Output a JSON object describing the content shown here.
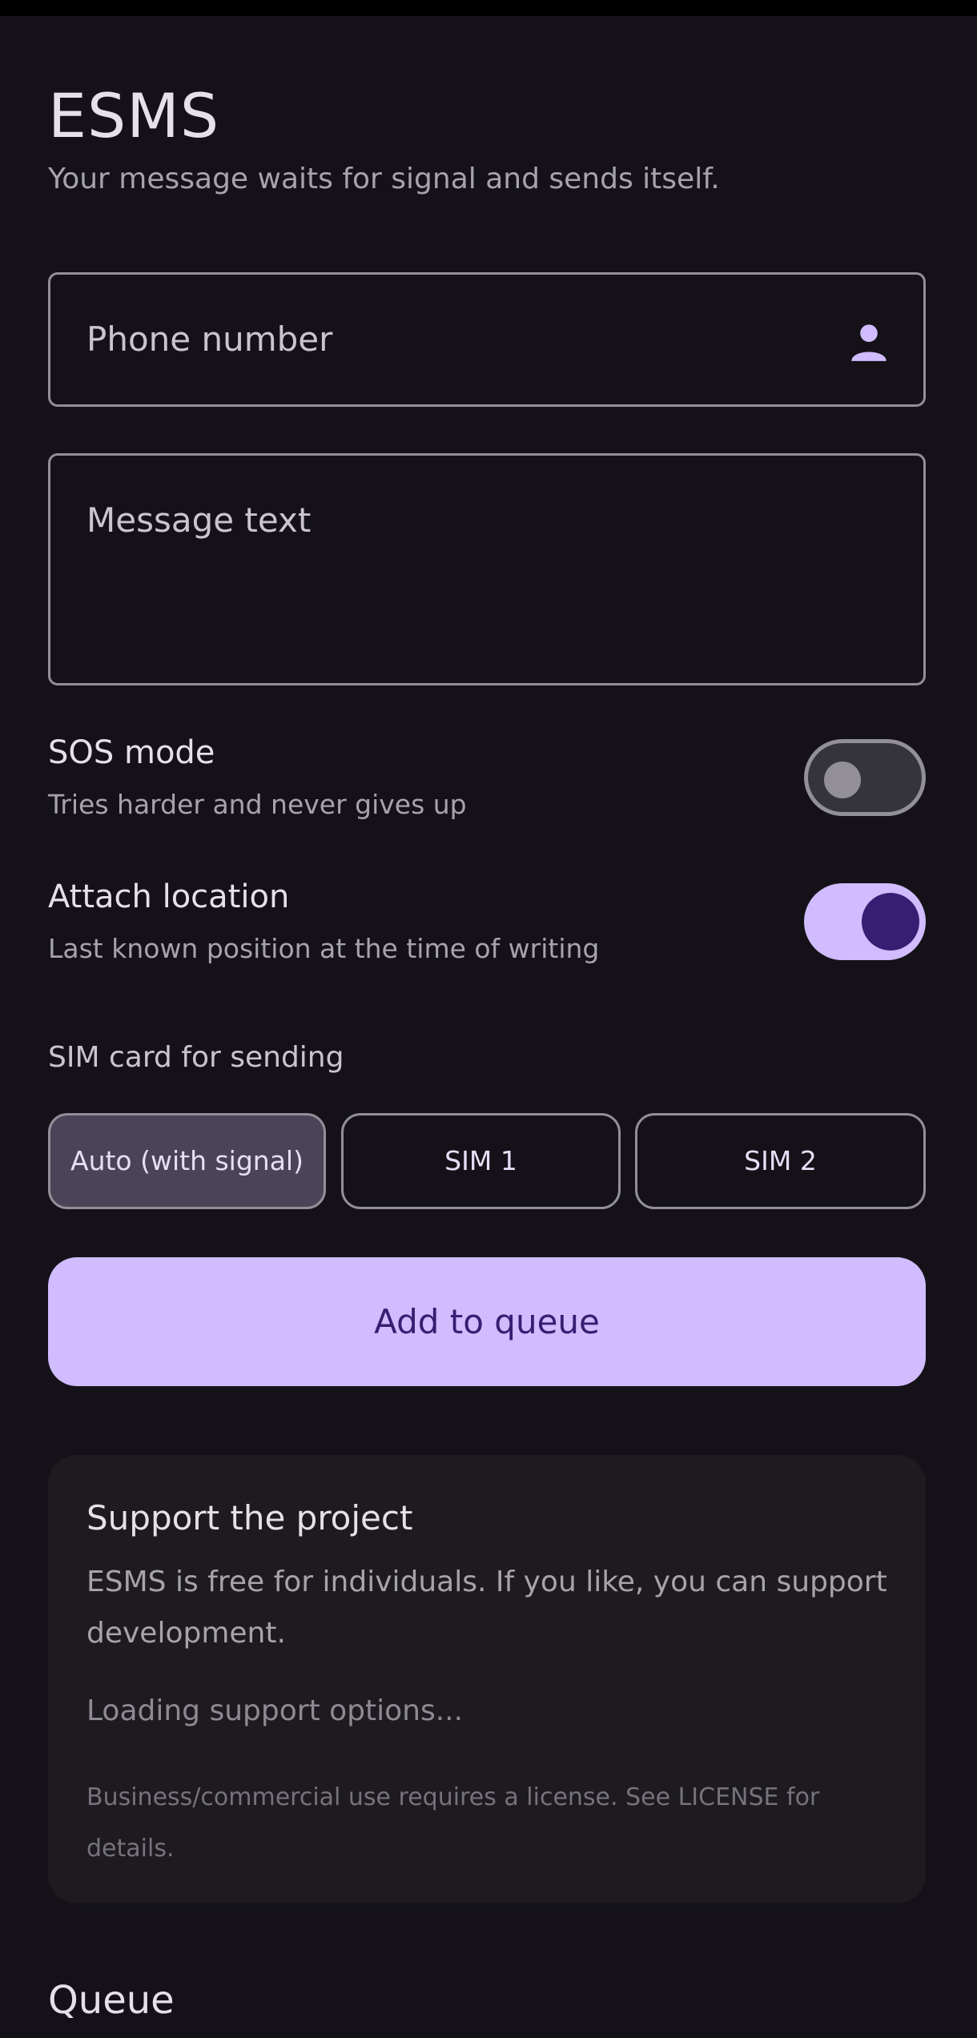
{
  "app": {
    "title": "ESMS",
    "subtitle": "Your message waits for signal and sends itself."
  },
  "form": {
    "phone_placeholder": "Phone number",
    "phone_icon": "person-icon",
    "message_placeholder": "Message text"
  },
  "settings": {
    "sos": {
      "title": "SOS mode",
      "description": "Tries harder and never gives up",
      "enabled": false
    },
    "location": {
      "title": "Attach location",
      "description": "Last known position at the time of writing",
      "enabled": true
    }
  },
  "sim": {
    "label": "SIM card for sending",
    "options": [
      "Auto (with signal)",
      "SIM 1",
      "SIM 2"
    ],
    "selected": "Auto (with signal)"
  },
  "actions": {
    "add_to_queue": "Add to queue"
  },
  "support": {
    "title": "Support the project",
    "body": "ESMS is free for individuals. If you like, you can support development.",
    "loading": "Loading support options...",
    "license_note": "Business/commercial use requires a license. See LICENSE for details."
  },
  "queue": {
    "heading": "Queue"
  },
  "colors": {
    "background": "#141218",
    "surface": "#1d1b20",
    "primary": "#d0bcff",
    "on_primary": "#381e72",
    "outline": "#938f99",
    "selected_chip": "#4a4458"
  }
}
